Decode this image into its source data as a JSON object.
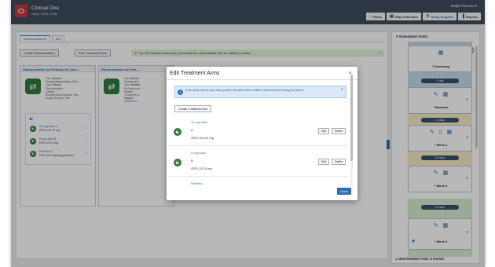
{
  "header": {
    "app_name": "Clinical One",
    "study_name": "Study ORCL 4785",
    "user_name": "Ralph Parsons ▾",
    "nav": [
      {
        "label": "Home",
        "icon": "home-icon",
        "glyph": "⌂"
      },
      {
        "label": "Data Collection",
        "icon": "data-collection-icon",
        "glyph": "▤"
      },
      {
        "label": "Study Supplies",
        "icon": "study-supplies-icon",
        "glyph": "⚗"
      },
      {
        "label": "Reports",
        "icon": "reports-icon",
        "glyph": "▐"
      }
    ],
    "active_nav": "Study Supplies"
  },
  "tabs": [
    "Randomizations",
    "Kits"
  ],
  "toolbar": {
    "create_label": "Create Randomization",
    "edit_arms_label": "Edit Treatment Arms",
    "tip": "Tip: The treatment arms you just created are now available here for editing or review."
  },
  "randomizations": [
    {
      "title": "Randomization for Protocol 09-June...",
      "meta": [
        {
          "label": "Visit:",
          "value": "Baseline"
        },
        {
          "label": "",
          "value": "Central randomization, 3 tre..."
        },
        {
          "label": "Type:",
          "value": "Blinded"
        },
        {
          "label": "Randomization:",
          "value": ""
        },
        {
          "label": "",
          "value": "Central"
        },
        {
          "label": "Restrict Randomization:",
          "value": "Yes"
        },
        {
          "label": "Assign Dropped:",
          "value": "Yes"
        }
      ],
      "arms": [
        {
          "name": "10 mg dose A",
          "desc": "ORS-123 10 mg"
        },
        {
          "name": "5 mg dose B",
          "desc": "ORS-123 5 mg"
        },
        {
          "name": "Placebo C",
          "desc": "ORS-123 Matching placebo"
        }
      ]
    },
    {
      "title": "Randomization for Prot...",
      "meta": [
        {
          "label": "Visit:",
          "value": "Week 6"
        },
        {
          "label": "",
          "value": "Central rand..."
        },
        {
          "label": "Type:",
          "value": "Blinded"
        },
        {
          "label": "Re-Randomiz...",
          "value": ""
        },
        {
          "label": "",
          "value": "Central"
        },
        {
          "label": "Treatment Ar...",
          "value": ""
        },
        {
          "label": "",
          "value": "Mapped"
        },
        {
          "label": "",
          "value": "View Rules"
        }
      ]
    }
  ],
  "modal": {
    "title": "Edit Treatment Arms",
    "info": "If the study has an open label period, the titles will be visible to blinded users during the period.",
    "create_label": "Create Treatment Arm",
    "edit_label": "Edit",
    "delete_label": "Delete",
    "done_label": "Done",
    "arms": [
      {
        "name": "10 mg dose",
        "code": "A",
        "desc": "ORS-123 10 mg"
      },
      {
        "name": "5 mg dose",
        "code": "B",
        "desc": "ORS-123 5 mg"
      },
      {
        "name": "Placebo",
        "code": "",
        "desc": ""
      }
    ]
  },
  "visits_panel": {
    "title": "Scheduled Visits",
    "bottom_label": "Unscheduled Visits & Events",
    "visits": [
      {
        "name": "* Screening"
      },
      {
        "name": "* Baseline"
      },
      {
        "name": "* Week 2"
      },
      {
        "name": "* Week 4"
      },
      {
        "name": "* Week 6"
      }
    ],
    "day_labels": [
      "0 day",
      "14 days",
      "28 days",
      "42 days"
    ],
    "lane_colors": [
      "#c6dae9",
      "#f6ecc4",
      "#d7ecd2"
    ]
  },
  "colors": {
    "header": "#3f4d5e",
    "accent": "#2a6eb5",
    "arm_green": "#2f7a3f",
    "logo_red": "#c8373a"
  }
}
